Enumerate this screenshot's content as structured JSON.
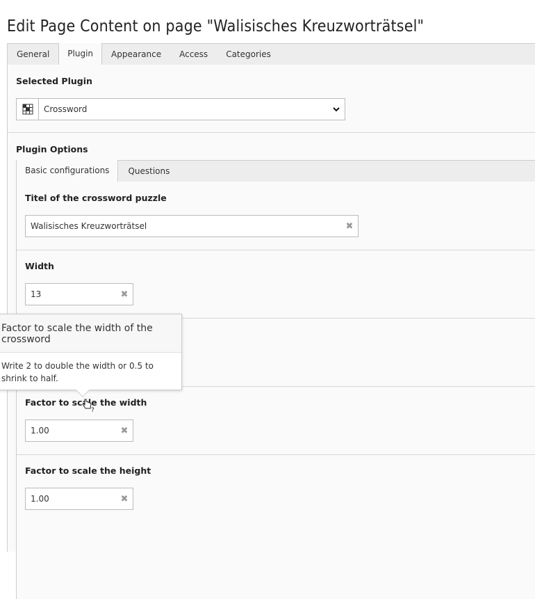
{
  "page": {
    "title": "Edit Page Content on page \"Walisisches Kreuzworträtsel\""
  },
  "tabs": [
    {
      "label": "General"
    },
    {
      "label": "Plugin"
    },
    {
      "label": "Appearance"
    },
    {
      "label": "Access"
    },
    {
      "label": "Categories"
    }
  ],
  "plugin": {
    "selected_label": "Selected Plugin",
    "selected_value": "Crossword",
    "options_label": "Plugin Options"
  },
  "subtabs": [
    {
      "label": "Basic configurations"
    },
    {
      "label": "Questions"
    }
  ],
  "fields": {
    "title": {
      "label": "Titel of the crossword puzzle",
      "value": "Walisisches Kreuzworträtsel"
    },
    "width": {
      "label": "Width",
      "value": "13"
    },
    "scale_width": {
      "label": "Factor to scale the width",
      "value": "1.00"
    },
    "scale_height": {
      "label": "Factor to scale the height",
      "value": "1.00"
    }
  },
  "tooltip": {
    "title": "Factor to scale the width of the crossword",
    "body": "Write 2 to double the width or 0.5 to shrink to half."
  },
  "icons": {
    "plugin_icon": "crossword-grid-icon",
    "clear_icon": "close-icon",
    "dropdown_icon": "chevron-down-icon",
    "cursor_icon": "help-cursor-icon"
  }
}
